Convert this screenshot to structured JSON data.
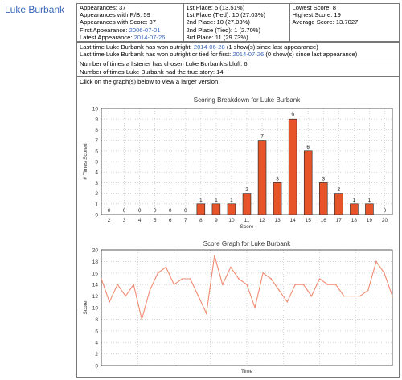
{
  "player_name": "Luke Burbank",
  "stats": {
    "col1": [
      {
        "label": "Appearances: 37",
        "link": ""
      },
      {
        "label": "Appearances with R/B: 59",
        "link": ""
      },
      {
        "label": "Appearances with Score: 37",
        "link": ""
      },
      {
        "label": "First Appearance: ",
        "link": "2006-07-01"
      },
      {
        "label": "Latest Appearance: ",
        "link": "2014-07-26"
      }
    ],
    "col2": [
      "1st Place: 5 (13.51%)",
      "1st Place (Tied): 10 (27.03%)",
      "2nd Place: 10 (27.03%)",
      "2nd Place (Tied): 1 (2.70%)",
      "3rd Place: 11 (29.73%)"
    ],
    "col3": [
      "Lowest Score: 8",
      "Highest Score: 19",
      "Average Score: 13.7027"
    ]
  },
  "wins": {
    "outright_prefix": "Last time Luke Burbank has won outright: ",
    "outright_date": "2014-06-28",
    "outright_suffix": " (1 show(s) since last appearance)",
    "tied_prefix": "Last time Luke Burbank has won outright or tied for first: ",
    "tied_date": "2014-07-26",
    "tied_suffix": " (0 show(s) since last appearance)"
  },
  "bluff": {
    "chosen": "Number of times a listener has chosen Luke Burbank's bluff: 6",
    "true_story": "Number of times Luke Burbank had the true story: 14"
  },
  "graph_hint": "Click on the graph(s) below to view a larger version.",
  "colors": {
    "bar": "#e8542a",
    "line": "#f08a70",
    "link": "#3a67b8"
  },
  "chart_data": [
    {
      "type": "bar",
      "title": "Scoring Breakdown for Luke Burbank",
      "xlabel": "Score",
      "ylabel": "# Times Scored",
      "categories": [
        2,
        3,
        4,
        5,
        6,
        7,
        8,
        9,
        10,
        11,
        12,
        13,
        14,
        15,
        16,
        17,
        18,
        19,
        20
      ],
      "values": [
        0,
        0,
        0,
        0,
        0,
        0,
        1,
        1,
        1,
        2,
        7,
        3,
        9,
        6,
        3,
        2,
        1,
        1,
        0
      ],
      "ylim": [
        0,
        10
      ],
      "yticks": [
        0,
        1,
        2,
        3,
        4,
        5,
        6,
        7,
        8,
        9,
        10
      ]
    },
    {
      "type": "line",
      "title": "Score Graph for Luke Burbank",
      "xlabel": "Time",
      "ylabel": "Score",
      "values": [
        15,
        11,
        14,
        12,
        14,
        8,
        13,
        16,
        17,
        14,
        15,
        15,
        12,
        9,
        19,
        14,
        17,
        15,
        14,
        10,
        16,
        15,
        13,
        11,
        14,
        14,
        12,
        15,
        14,
        14,
        12,
        12,
        12,
        13,
        18,
        16,
        12
      ],
      "ylim": [
        0,
        20
      ],
      "yticks": [
        0,
        2,
        4,
        6,
        8,
        10,
        12,
        14,
        16,
        18,
        20
      ]
    }
  ]
}
